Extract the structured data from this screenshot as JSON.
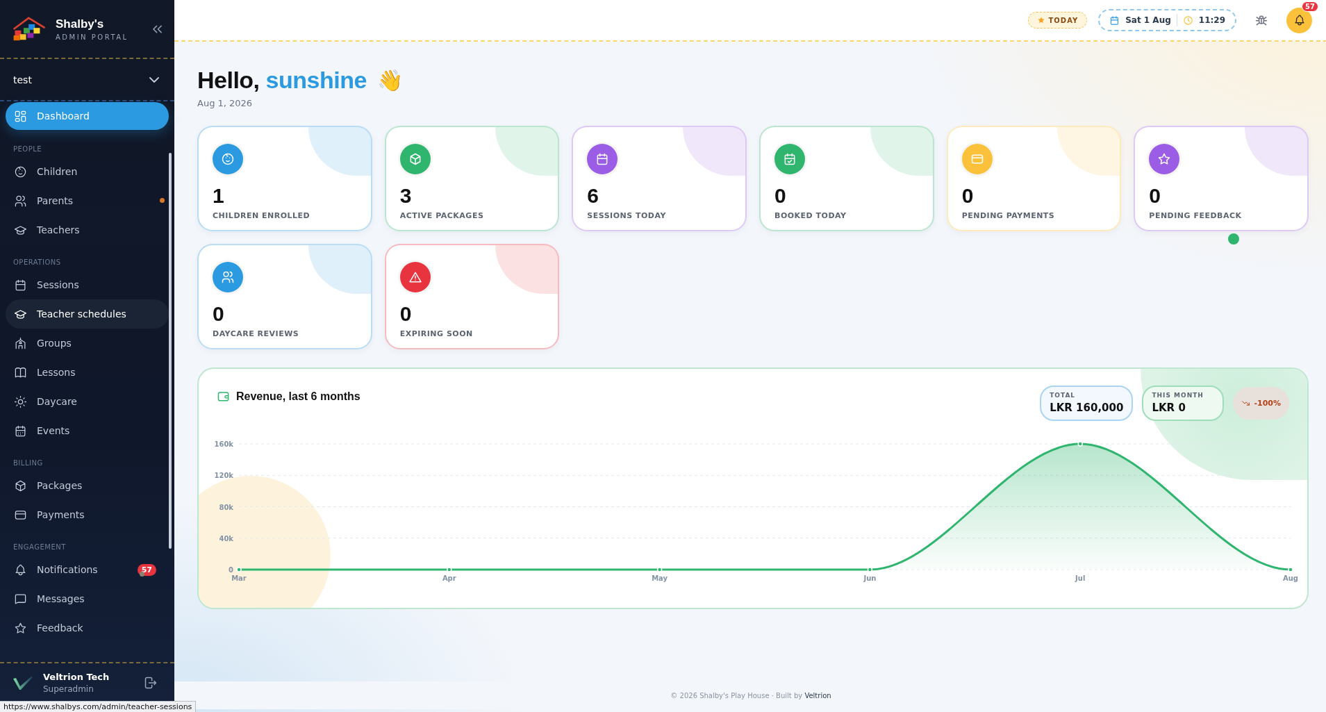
{
  "sidebar": {
    "brand": {
      "name": "Shalby's",
      "subtitle": "ADMIN PORTAL"
    },
    "workspace_select": {
      "value": "test"
    },
    "groups": [
      {
        "items": [
          {
            "label": "Dashboard",
            "selected": true,
            "hovered": false
          }
        ]
      },
      {
        "heading": "PEOPLE",
        "items": [
          {
            "label": "Children",
            "selected": false,
            "hovered": false
          },
          {
            "label": "Parents",
            "selected": false,
            "hovered": false,
            "color": "#d9772b"
          },
          {
            "label": "Teachers",
            "selected": false,
            "hovered": false
          }
        ]
      },
      {
        "heading": "OPERATIONS",
        "items": [
          {
            "label": "Sessions",
            "selected": false,
            "hovered": false
          },
          {
            "label": "Teacher schedules",
            "selected": false,
            "hovered": true
          },
          {
            "label": "Groups",
            "selected": false,
            "hovered": false
          },
          {
            "label": "Lessons",
            "selected": false,
            "hovered": false
          },
          {
            "label": "Daycare",
            "selected": false,
            "hovered": false
          },
          {
            "label": "Events",
            "selected": false,
            "hovered": false
          }
        ]
      },
      {
        "heading": "BILLING",
        "items": [
          {
            "label": "Packages",
            "selected": false,
            "hovered": false
          },
          {
            "label": "Payments",
            "selected": false,
            "hovered": false
          }
        ]
      },
      {
        "heading": "ENGAGEMENT",
        "items": [
          {
            "label": "Notifications",
            "selected": false,
            "hovered": false,
            "badge": "57",
            "color": "#8a8272"
          },
          {
            "label": "Messages",
            "selected": false,
            "hovered": false
          },
          {
            "label": "Feedback",
            "selected": false,
            "hovered": false
          }
        ]
      }
    ],
    "user": {
      "name": "Veltrion Tech",
      "role": "Superadmin"
    }
  },
  "header": {
    "today_badge": "TODAY",
    "date": "Sat 1 Aug",
    "time": "11:29",
    "notification_count": "57"
  },
  "greeting": {
    "text": "Hello,",
    "name": "sunshine",
    "emoji": "👋",
    "date": "Aug 1, 2026"
  },
  "stats": [
    {
      "value": "1",
      "label": "CHILDREN ENROLLED",
      "color": "#2b9ae0"
    },
    {
      "value": "3",
      "label": "ACTIVE PACKAGES",
      "color": "#2fb56e"
    },
    {
      "value": "6",
      "label": "SESSIONS TODAY",
      "color": "#9b5de5"
    },
    {
      "value": "0",
      "label": "BOOKED TODAY",
      "color": "#2fb56e"
    },
    {
      "value": "0",
      "label": "PENDING PAYMENTS",
      "color": "#fbc13a"
    },
    {
      "value": "0",
      "label": "PENDING FEEDBACK",
      "color": "#9b5de5"
    },
    {
      "value": "0",
      "label": "DAYCARE REVIEWS",
      "color": "#2b9ae0"
    },
    {
      "value": "0",
      "label": "EXPIRING SOON",
      "color": "#e8343f"
    }
  ],
  "revenue": {
    "title": "Revenue, last 6 months",
    "total": {
      "label": "TOTAL",
      "value": "LKR 160,000"
    },
    "this_month": {
      "label": "THIS MONTH",
      "value": "LKR 0"
    },
    "change": "-100%",
    "chart_data": {
      "type": "area",
      "categories": [
        "Mar",
        "Apr",
        "May",
        "Jun",
        "Jul",
        "Aug"
      ],
      "series": [
        {
          "color": "#2fb56e",
          "values": [
            0,
            0,
            0,
            0,
            160000,
            0
          ]
        }
      ],
      "grid": true,
      "ylim": [
        0,
        160000
      ],
      "yticks": [
        {
          "value": 0,
          "label": "0"
        },
        {
          "value": 40000,
          "label": "40k"
        },
        {
          "value": 80000,
          "label": "80k"
        },
        {
          "value": 120000,
          "label": "120k"
        },
        {
          "value": 160000,
          "label": "160k"
        }
      ]
    }
  },
  "footer": {
    "text": "© 2026 Shalby's Play House · Built by",
    "link": "Veltrion"
  },
  "status_bar": {
    "url": "https://www.shalbys.com/admin/teacher-sessions"
  }
}
